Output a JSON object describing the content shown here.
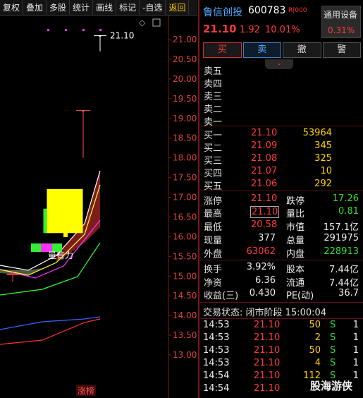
{
  "toolbar": {
    "items": [
      "复权",
      "叠加",
      "多股",
      "统计",
      "画线",
      "标记",
      "-自选",
      "返回"
    ]
  },
  "chart": {
    "price_label_last": "21.10",
    "annotation": "量有力",
    "bottom_tag": "涨榜"
  },
  "chart_data": {
    "type": "candlestick",
    "y_ticks": [
      "21.00",
      "20.50",
      "20.00",
      "19.50",
      "19.00",
      "18.50",
      "18.00",
      "17.50",
      "17.00",
      "16.50",
      "16.00",
      "15.50",
      "15.00",
      "14.50",
      "14.00",
      "13.50",
      "13.00"
    ],
    "ylim": [
      12.8,
      21.4
    ],
    "candles": [
      {
        "open": 15.05,
        "close": 15.05,
        "high": 15.15,
        "low": 14.85,
        "color": "#ff3b3b",
        "fill": "none"
      },
      {
        "open": 16.1,
        "close": 16.7,
        "high": 16.7,
        "low": 16.1,
        "color": "#33ee33",
        "fill": "#33ee33"
      },
      {
        "open": 16.1,
        "close": 17.2,
        "high": 17.2,
        "low": 16.0,
        "color": "#ffff00",
        "fill": "#ffff00"
      },
      {
        "open": 19.2,
        "close": 19.2,
        "high": 19.2,
        "low": 18.0,
        "color": "#ff5555",
        "fill": "none"
      },
      {
        "open": 21.1,
        "close": 21.1,
        "high": 21.1,
        "low": 20.7,
        "color": "#ffffff",
        "fill": "none"
      }
    ],
    "ma_colors": [
      "#ffffff",
      "#ffff33",
      "#ff33ff",
      "#33ff33",
      "#ff3333",
      "#3366ff"
    ]
  },
  "stock": {
    "name": "鲁信创投",
    "code": "600783",
    "tag": "R|000",
    "price": "21.10",
    "change": "1.92",
    "pct": "10.01%"
  },
  "device": {
    "title": "通用设备",
    "value": "0.31%"
  },
  "trade_buttons": {
    "buy": "买",
    "sell": "卖",
    "cancel": "撤",
    "alert": "警"
  },
  "collapse_glyph": "⌄",
  "asks": [
    {
      "label": "卖五",
      "price": "",
      "vol": ""
    },
    {
      "label": "卖四",
      "price": "",
      "vol": ""
    },
    {
      "label": "卖三",
      "price": "",
      "vol": ""
    },
    {
      "label": "卖二",
      "price": "",
      "vol": ""
    },
    {
      "label": "卖一",
      "price": "",
      "vol": ""
    }
  ],
  "bids": [
    {
      "label": "买一",
      "price": "21.10",
      "vol": "53964"
    },
    {
      "label": "买二",
      "price": "21.09",
      "vol": "345"
    },
    {
      "label": "买三",
      "price": "21.08",
      "vol": "325"
    },
    {
      "label": "买四",
      "price": "21.07",
      "vol": "10"
    },
    {
      "label": "买五",
      "price": "21.06",
      "vol": "292"
    }
  ],
  "quote": {
    "limit_up_l": "涨停",
    "limit_up": "21.10",
    "limit_down_l": "跌停",
    "limit_down": "17.26",
    "high_l": "最高",
    "high": "21.10",
    "vol_ratio_l": "量比",
    "vol_ratio": "0.81",
    "low_l": "最低",
    "low": "20.58",
    "mktcap_l": "市值",
    "mktcap": "157.1亿",
    "last_vol_l": "现量",
    "last_vol": "377",
    "total_vol_l": "总量",
    "total_vol": "291975",
    "outer_l": "外盘",
    "outer": "63062",
    "inner_l": "内盘",
    "inner": "228913",
    "turnover_l": "换手",
    "turnover": "3.92%",
    "capital_l": "股本",
    "capital": "7.44亿",
    "nav_l": "净资",
    "nav": "6.36",
    "float_l": "流通",
    "float": "7.44亿",
    "eps_l": "收益(三)",
    "eps": "0.430",
    "pe_l": "PE(动)",
    "pe": "36.7"
  },
  "trade_status": "交易状态: 闭市阶段 15:00:04",
  "ticks": [
    {
      "time": "14:53",
      "price": "21.10",
      "vol": "50",
      "side": "S",
      "n": "1"
    },
    {
      "time": "14:53",
      "price": "21.10",
      "vol": "2",
      "side": "S",
      "n": "1"
    },
    {
      "time": "14:53",
      "price": "21.10",
      "vol": "50",
      "side": "S",
      "n": "1"
    },
    {
      "time": "14:53",
      "price": "21.10",
      "vol": "4",
      "side": "S",
      "n": "1"
    },
    {
      "time": "14:54",
      "price": "21.10",
      "vol": "112",
      "side": "S",
      "n": "1"
    },
    {
      "time": "14:54",
      "price": "21.10",
      "vol": "",
      "side": "",
      "n": ""
    }
  ],
  "watermark": "股海游侠"
}
